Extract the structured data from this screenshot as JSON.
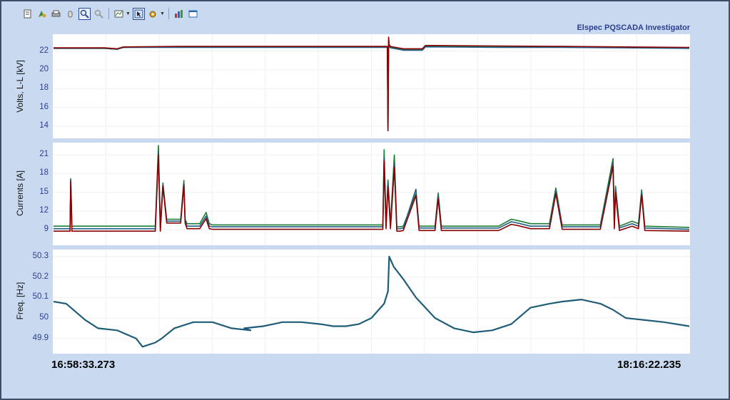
{
  "app": {
    "brand": "Elspec PQSCADA Investigator"
  },
  "toolbar": {
    "icons": [
      "properties-icon",
      "export-icon",
      "print-icon",
      "pan-icon",
      "zoom-in-icon",
      "zoom-out-icon",
      "chart-type-icon",
      "select-icon",
      "settings-icon",
      "report-icon",
      "window-icon"
    ]
  },
  "time_axis": {
    "start": "16:58:33.273",
    "end": "18:16:22.235"
  },
  "colors": {
    "line_red": "#8b0000",
    "line_green": "#1e7d32",
    "line_blue": "#1f5d86",
    "line_freq": "#1f5d78",
    "tick_text": "#2b3e8f"
  },
  "chart_data": [
    {
      "type": "line",
      "ylabel": "Volts, L-L [kV]",
      "ylim": [
        13,
        23.5
      ],
      "yticks": [
        14,
        16,
        18,
        20,
        22
      ],
      "x": [
        0,
        0.08,
        0.1,
        0.11,
        0.2,
        0.3,
        0.4,
        0.5,
        0.525,
        0.526,
        0.527,
        0.528,
        0.5285,
        0.53,
        0.55,
        0.58,
        0.585,
        0.6,
        0.7,
        0.8,
        0.9,
        1.0
      ],
      "series": [
        {
          "values": [
            22.3,
            22.3,
            22.2,
            22.4,
            22.45,
            22.45,
            22.45,
            22.45,
            22.45,
            13.6,
            23.4,
            22.5,
            22.6,
            22.45,
            22.2,
            22.2,
            22.55,
            22.55,
            22.5,
            22.45,
            22.4,
            22.35
          ]
        },
        {
          "values": [
            22.3,
            22.3,
            22.2,
            22.4,
            22.4,
            22.4,
            22.4,
            22.4,
            22.4,
            13.8,
            23.2,
            22.4,
            22.5,
            22.35,
            22.1,
            22.1,
            22.45,
            22.45,
            22.4,
            22.4,
            22.35,
            22.3
          ]
        },
        {
          "values": [
            22.35,
            22.35,
            22.25,
            22.45,
            22.5,
            22.5,
            22.5,
            22.5,
            22.5,
            13.5,
            23.5,
            22.55,
            22.65,
            22.5,
            22.25,
            22.25,
            22.6,
            22.6,
            22.55,
            22.5,
            22.45,
            22.4
          ]
        }
      ]
    },
    {
      "type": "line",
      "ylabel": "Currents [A]",
      "ylim": [
        7,
        22.5
      ],
      "yticks": [
        9,
        12,
        15,
        18,
        21
      ],
      "x": [
        0,
        0.026,
        0.027,
        0.029,
        0.16,
        0.165,
        0.168,
        0.172,
        0.178,
        0.185,
        0.2,
        0.205,
        0.207,
        0.21,
        0.23,
        0.24,
        0.245,
        0.25,
        0.3,
        0.4,
        0.45,
        0.518,
        0.52,
        0.523,
        0.526,
        0.53,
        0.536,
        0.54,
        0.545,
        0.55,
        0.57,
        0.575,
        0.58,
        0.6,
        0.605,
        0.61,
        0.7,
        0.72,
        0.73,
        0.75,
        0.78,
        0.79,
        0.8,
        0.82,
        0.86,
        0.88,
        0.882,
        0.884,
        0.89,
        0.91,
        0.92,
        0.925,
        0.93,
        1.0
      ],
      "series": [
        {
          "values": [
            9.6,
            9.6,
            17.2,
            9.6,
            9.6,
            22.5,
            9.6,
            16.5,
            10.7,
            10.7,
            10.7,
            16.9,
            10.7,
            10,
            10,
            11.8,
            10,
            9.8,
            9.8,
            9.8,
            9.8,
            9.8,
            21.8,
            10,
            17,
            10,
            21,
            9.5,
            9.5,
            9.6,
            14.8,
            9.6,
            9.6,
            9.6,
            14.9,
            9.6,
            9.6,
            10.7,
            10.5,
            10,
            10,
            15.7,
            9.8,
            9.8,
            9.8,
            20.4,
            10,
            16,
            9.6,
            10.4,
            10,
            15.4,
            9.6,
            9.4
          ]
        },
        {
          "values": [
            9.2,
            9.2,
            17,
            9.2,
            9.2,
            21.5,
            9.2,
            16.2,
            10.4,
            10.4,
            10.4,
            16.5,
            10.4,
            9.6,
            9.6,
            11.2,
            9.6,
            9.5,
            9.5,
            9.5,
            9.5,
            9.5,
            20.5,
            9.6,
            16.5,
            9.6,
            19.5,
            9.2,
            9.2,
            9.3,
            15.5,
            9.3,
            9.3,
            9.3,
            14.5,
            9.3,
            9.3,
            10.3,
            10.1,
            9.6,
            9.6,
            15.2,
            9.5,
            9.5,
            9.5,
            19.8,
            9.6,
            15.5,
            9.3,
            10,
            9.6,
            15,
            9.3,
            9.1
          ]
        },
        {
          "values": [
            8.8,
            8.8,
            16.8,
            8.8,
            8.8,
            21,
            8.8,
            16,
            10.1,
            10.1,
            10.1,
            16.2,
            10.1,
            9.2,
            9.2,
            10.8,
            9.2,
            9.1,
            9.1,
            9.1,
            9.1,
            9.1,
            20,
            9.2,
            16,
            9.2,
            19,
            8.8,
            8.8,
            8.9,
            14.5,
            8.9,
            8.9,
            8.9,
            14,
            8.9,
            8.9,
            9.9,
            9.7,
            9.2,
            9.2,
            14.8,
            9.1,
            9.1,
            9.1,
            19.2,
            9.2,
            15,
            8.9,
            9.6,
            9.2,
            14.6,
            8.9,
            8.8
          ]
        }
      ]
    },
    {
      "type": "line",
      "ylabel": "Freq. [Hz]",
      "ylim": [
        49.84,
        50.32
      ],
      "yticks": [
        49.9,
        50,
        50.1,
        50.2,
        50.3
      ],
      "x": [
        0,
        0.02,
        0.05,
        0.07,
        0.1,
        0.13,
        0.14,
        0.16,
        0.17,
        0.19,
        0.22,
        0.25,
        0.28,
        0.31,
        0.3,
        0.33,
        0.36,
        0.39,
        0.42,
        0.44,
        0.46,
        0.48,
        0.5,
        0.52,
        0.526,
        0.528,
        0.535,
        0.55,
        0.57,
        0.6,
        0.63,
        0.66,
        0.69,
        0.72,
        0.75,
        0.78,
        0.8,
        0.83,
        0.86,
        0.88,
        0.9,
        0.93,
        0.96,
        1.0
      ],
      "series": [
        {
          "values": [
            50.08,
            50.07,
            49.99,
            49.95,
            49.94,
            49.9,
            49.86,
            49.88,
            49.9,
            49.95,
            49.98,
            49.98,
            49.95,
            49.94,
            49.95,
            49.96,
            49.98,
            49.98,
            49.97,
            49.96,
            49.96,
            49.97,
            50.0,
            50.07,
            50.13,
            50.3,
            50.25,
            50.19,
            50.1,
            50.0,
            49.95,
            49.93,
            49.94,
            49.97,
            50.05,
            50.07,
            50.08,
            50.09,
            50.07,
            50.04,
            50.0,
            49.99,
            49.98,
            49.96
          ]
        }
      ]
    }
  ]
}
